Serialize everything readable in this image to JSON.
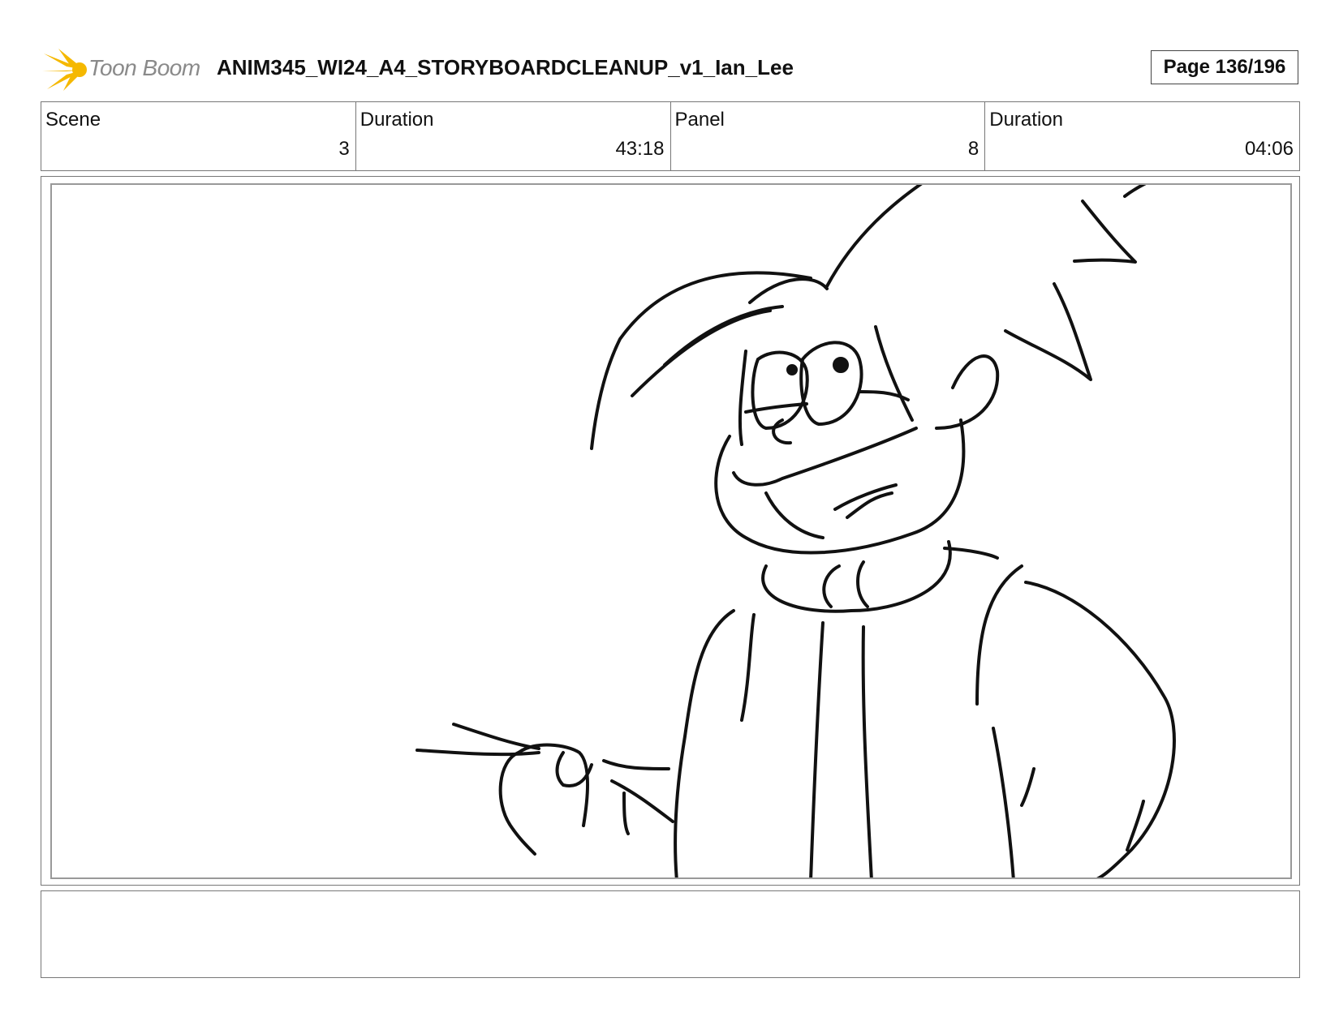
{
  "header": {
    "logo_text": "Toon Boom",
    "logo_icon": "starburst-logo-icon",
    "title": "ANIM345_WI24_A4_STORYBOARDCLEANUP_v1_Ian_Lee",
    "page_label": "Page 136/196"
  },
  "info": {
    "scene_label": "Scene",
    "scene_value": "3",
    "scene_duration_label": "Duration",
    "scene_duration_value": "43:18",
    "panel_label": "Panel",
    "panel_value": "8",
    "panel_duration_label": "Duration",
    "panel_duration_value": "04:06"
  },
  "panel": {
    "content": "storyboard-sketch"
  },
  "notes": {
    "text": ""
  },
  "colors": {
    "logo_yellow": "#f5b800",
    "logo_text": "#8a8a8a",
    "border": "#777777",
    "ink": "#111111"
  }
}
